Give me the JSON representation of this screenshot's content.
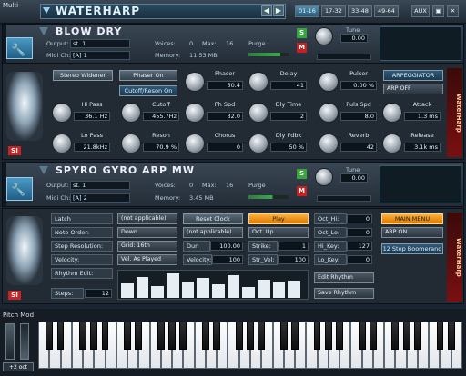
{
  "app": {
    "window_label": "Multi",
    "multi_name": "WATERHARP"
  },
  "pages": [
    "01-16",
    "17-32",
    "33-48",
    "49-64"
  ],
  "top_buttons": [
    "AUX"
  ],
  "inst1": {
    "name": "BLOW DRY",
    "output_label": "Output:",
    "output_value": "st. 1",
    "midi_label": "Midi Ch:",
    "midi_value": "[A] 1",
    "voices_label": "Voices:",
    "voices_value": "0",
    "max_label": "Max:",
    "max_value": "16",
    "memory_label": "Memory:",
    "memory_value": "11.53 MB",
    "purge_label": "Purge",
    "tune_label": "Tune",
    "tune_value": "0.00",
    "solo": "S",
    "mute": "M"
  },
  "fx": {
    "stereo_widener": "Stereo Widener",
    "phaser_on": "Phaser On",
    "cutoff_reson_on": "Cutoff/Reson On",
    "arpeggiator": "ARPEGGIATOR",
    "arp_off": "ARP OFF",
    "knobs": [
      {
        "label": "Hi Pass",
        "value": "36.1 Hz"
      },
      {
        "label": "Cutoff",
        "value": "455.7Hz"
      },
      {
        "label": "Phaser",
        "value": "50.4"
      },
      {
        "label": "Delay",
        "value": "41"
      },
      {
        "label": "Pulser",
        "value": "0.00 %"
      },
      {
        "label": "Lo Pass",
        "value": "21.8kHz"
      },
      {
        "label": "Reson",
        "value": "70.9 %"
      },
      {
        "label": "Ph Spd",
        "value": "32.0"
      },
      {
        "label": "Dly Time",
        "value": "2"
      },
      {
        "label": "Puls Spd",
        "value": "8.0"
      },
      {
        "label": "Attack",
        "value": "1.3 ms"
      },
      {
        "label": "Chorus",
        "value": "0"
      },
      {
        "label": "Dly Fdbk",
        "value": "50 %"
      },
      {
        "label": "Reverb",
        "value": "42"
      },
      {
        "label": "Release",
        "value": "3.1k ms"
      }
    ]
  },
  "inst2": {
    "name": "SPYRO GYRO ARP MW",
    "output_label": "Output:",
    "output_value": "st. 1",
    "midi_label": "Midi Ch:",
    "midi_value": "[A] 2",
    "voices_label": "Voices:",
    "voices_value": "0",
    "max_label": "Max:",
    "max_value": "16",
    "memory_label": "Memory:",
    "memory_value": "3.45 MB",
    "purge_label": "Purge",
    "tune_label": "Tune",
    "tune_value": "0.00",
    "solo": "S",
    "mute": "M"
  },
  "arp": {
    "latch": "Latch",
    "note_order": "Note Order:",
    "step_resolution": "Step Resolution:",
    "velocity": "Velocity:",
    "rhythm_edit": "Rhythm Edit:",
    "steps_label": "Steps:",
    "steps_value": "12",
    "dd1": "(not applicable)",
    "dd2": "Down",
    "dd3": "Grid: 16th",
    "dd4": "Vel. As Played",
    "reset_clock": "Reset Clock",
    "dd5": "(not applicable)",
    "dd6": "(not applicable)",
    "dur_label": "Dur:",
    "dur_value": "100.00",
    "velocity2_label": "Velocity:",
    "velocity2_value": "100",
    "play": "Play",
    "oct_up": "Oct. Up",
    "strike_label": "Strike:",
    "strike_value": "1",
    "str_vel_label": "Str_Vel:",
    "str_vel_value": "100",
    "oct_hi_label": "Oct_Hi:",
    "oct_hi_value": "0",
    "oct_lo_label": "Oct_Lo:",
    "oct_lo_value": "0",
    "hi_key_label": "Hi_Key:",
    "hi_key_value": "127",
    "lo_key_label": "Lo_Key:",
    "lo_key_value": "0",
    "edit_rhythm": "Edit Rhythm",
    "save_rhythm": "Save Rhythm",
    "main_menu": "MAIN MENU",
    "arp_on": "ARP ON",
    "step_boomerang": "12 Step Boomerang",
    "rhythm_bars": [
      0.55,
      0.78,
      0.45,
      0.92,
      0.62,
      0.75,
      0.5,
      0.85,
      0.4,
      0.7,
      0.58,
      0.66
    ]
  },
  "keyboard": {
    "pitch_mod": "Pitch Mod",
    "octave": "+2 oct"
  },
  "brand": "WaterHarp",
  "colors": {
    "accent_orange": "#f59b1a",
    "solo_green": "#3aa53a",
    "mute_red": "#c72020"
  }
}
